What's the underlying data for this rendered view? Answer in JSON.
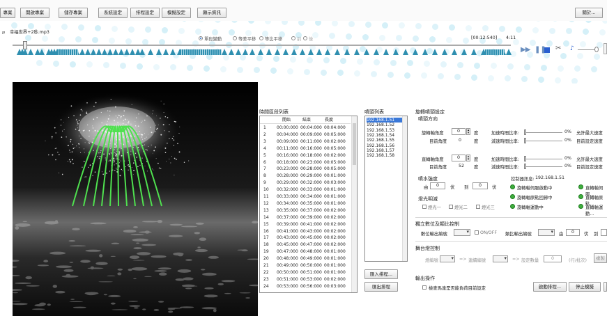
{
  "toolbar": {
    "buttons": [
      "專案",
      "開啟專案",
      "儲存專案",
      "系統設定",
      "排程設定",
      "模擬設定",
      "顯示資訊"
    ],
    "right_button": "關於..."
  },
  "song": {
    "title": "幸福世界+2秒.mp3"
  },
  "playmode": {
    "options": [
      "單段變動",
      "等差平移",
      "等比平移"
    ],
    "extra": [
      "前",
      "後"
    ],
    "selected": 0
  },
  "time": {
    "position": "[00:12:540]",
    "total": "4:11"
  },
  "colors": {
    "marker": "#2f8fb0",
    "water": "#4fe04f",
    "status_dot": "#3fae3f"
  },
  "time_list": {
    "title": "時間區段列表",
    "headers": [
      "",
      "開始",
      "結束",
      "長度"
    ],
    "rows": [
      [
        "1",
        "00:00:000",
        "00:04:000",
        "00:04:000"
      ],
      [
        "2",
        "00:04:000",
        "00:09:000",
        "00:05:000"
      ],
      [
        "3",
        "00:09:000",
        "00:11:000",
        "00:02:000"
      ],
      [
        "4",
        "00:11:000",
        "00:16:000",
        "00:05:000"
      ],
      [
        "5",
        "00:16:000",
        "00:18:000",
        "00:02:000"
      ],
      [
        "6",
        "00:18:000",
        "00:23:000",
        "00:05:000"
      ],
      [
        "7",
        "00:23:000",
        "00:28:000",
        "00:05:000"
      ],
      [
        "8",
        "00:28:000",
        "00:29:000",
        "00:01:000"
      ],
      [
        "9",
        "00:29:000",
        "00:32:000",
        "00:03:000"
      ],
      [
        "10",
        "00:32:000",
        "00:33:000",
        "00:01:000"
      ],
      [
        "11",
        "00:33:000",
        "00:34:000",
        "00:01:000"
      ],
      [
        "12",
        "00:34:000",
        "00:35:000",
        "00:01:000"
      ],
      [
        "13",
        "00:35:000",
        "00:37:000",
        "00:02:000"
      ],
      [
        "14",
        "00:37:000",
        "00:39:000",
        "00:02:000"
      ],
      [
        "15",
        "00:39:000",
        "00:41:000",
        "00:02:000"
      ],
      [
        "16",
        "00:41:000",
        "00:43:000",
        "00:02:000"
      ],
      [
        "17",
        "00:43:000",
        "00:45:000",
        "00:02:000"
      ],
      [
        "18",
        "00:45:000",
        "00:47:000",
        "00:02:000"
      ],
      [
        "19",
        "00:47:000",
        "00:48:000",
        "00:01:000"
      ],
      [
        "20",
        "00:48:000",
        "00:49:000",
        "00:01:000"
      ],
      [
        "21",
        "00:49:000",
        "00:50:000",
        "00:01:000"
      ],
      [
        "22",
        "00:50:000",
        "00:51:000",
        "00:01:000"
      ],
      [
        "23",
        "00:51:000",
        "00:53:000",
        "00:02:000"
      ],
      [
        "24",
        "00:53:000",
        "00:56:000",
        "00:03:000"
      ]
    ]
  },
  "device_list": {
    "title": "噴頭列表",
    "items": [
      "192.168.1.51",
      "192.168.1.52",
      "192.168.1.53",
      "192.168.1.54",
      "192.168.1.55",
      "192.168.1.56",
      "192.168.1.57",
      "192.168.1.58"
    ],
    "import_button": "匯入排程...",
    "export_button": "匯出排程"
  },
  "rotation": {
    "title": "旋轉噴頭設定",
    "dir_title": "噴頭方向",
    "rot_label": "旋轉軸角度",
    "rot_value": "0",
    "rot_target_label": "目前角度",
    "rot_target_value": "0",
    "deg": "度",
    "vert_label": "直轉軸角度",
    "vert_value": "0",
    "vert_target_label": "目前角度",
    "vert_target_value": "52",
    "accel_label": "加速時間比率:",
    "decel_label": "減速時間比率:",
    "pct": "0%",
    "max_speed_label": "允許最大速度",
    "cur_speed_label": "目前設定速度"
  },
  "pressure": {
    "title": "噴水強度",
    "from_label": "由",
    "from_value": "0",
    "unit": "伏",
    "to_label": "到",
    "to_value": "0"
  },
  "lights": {
    "title": "燈光明滅",
    "items": [
      "燈光一",
      "燈光二",
      "燈光三"
    ]
  },
  "status": {
    "title": "控制器訊息:",
    "ip": "192.168.1.51",
    "items": [
      "旋轉軸伺服啟動中",
      "直轉軸伺服...",
      "旋轉軸原點回歸中",
      "直轉軸原點...",
      "旋轉軸運動中",
      "直轉軸運動..."
    ]
  },
  "independent": {
    "title": "獨立數位及類比控制",
    "digital_label": "數位輸出編號",
    "onoff": "ON/OFF",
    "analog_label": "類比輸出編號",
    "from_label": "由",
    "from_value": "0",
    "unit": "伏",
    "to_label": "到"
  },
  "multi": {
    "title": "舞台燈控制",
    "src_label": "燈編號",
    "arrow": "=>",
    "dst_label": "連續編號",
    "count_label": "設定數量",
    "count_value": "0",
    "range_label": "(行/批次)",
    "copy_button": "複製"
  },
  "output": {
    "title": "輸出操作",
    "check_label": "檢查馬達是否能負荷目前設定",
    "run_button": "啟動排程...",
    "stop_button": "停止模擬"
  }
}
